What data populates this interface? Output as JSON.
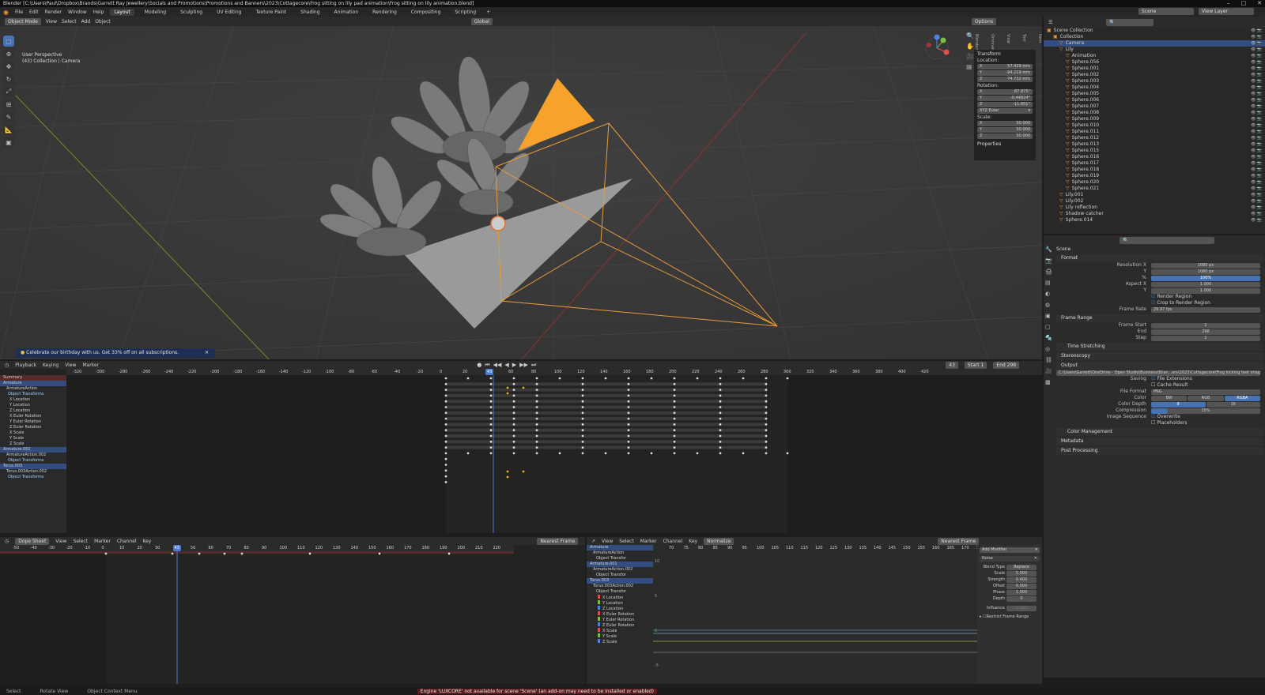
{
  "window": {
    "title": "Blender [C:\\Users\\Paul\\Dropbox\\Brands\\Garrett Ray Jewellery\\Socials and Promotions\\Promotions and Banners\\2023\\Cottagecore\\Frog sitting on lily pad animation\\Frog sitting on lily animation.blend]",
    "minimize": "–",
    "maximize": "□",
    "close": "✕"
  },
  "menubar": {
    "menus": [
      "File",
      "Edit",
      "Render",
      "Window",
      "Help"
    ],
    "workspaces": [
      "Layout",
      "Modeling",
      "Sculpting",
      "UV Editing",
      "Texture Paint",
      "Shading",
      "Animation",
      "Rendering",
      "Compositing",
      "Scripting"
    ],
    "active_workspace": "Layout",
    "add_tab": "+",
    "scene_label": "Scene",
    "view_layer_label": "View Layer"
  },
  "viewport": {
    "mode": "Object Mode",
    "menus": [
      "View",
      "Select",
      "Add",
      "Object"
    ],
    "orientation": "Global",
    "options": "Options",
    "info_line1": "User Perspective",
    "info_line2": "(43) Collection | Camera",
    "banner": "Celebrate our birthday with us. Get 33% off on all subscriptions.",
    "banner_close": "✕",
    "gizmo": {
      "x": "X",
      "y": "Y",
      "z": "Z"
    },
    "npanel_tabs": [
      "Item",
      "Tool",
      "View",
      "Omniverse",
      "Blenderkit"
    ]
  },
  "transform": {
    "header": "Transform",
    "location_label": "Location:",
    "location": [
      [
        "X",
        "57.429 mm"
      ],
      [
        "Y",
        "-94.219 mm"
      ],
      [
        "Z",
        "74.732 mm"
      ]
    ],
    "rotation_label": "Rotation:",
    "rotation": [
      [
        "X",
        "87.875°"
      ],
      [
        "Y",
        "-0.44824°"
      ],
      [
        "Z",
        "-11.851°"
      ]
    ],
    "rotation_mode": "XYZ Euler",
    "scale_label": "Scale:",
    "scale": [
      [
        "X",
        "50.000"
      ],
      [
        "Y",
        "50.000"
      ],
      [
        "Z",
        "50.000"
      ]
    ],
    "properties": "Properties"
  },
  "outliner": {
    "rows": [
      {
        "label": "Scene Collection",
        "indent": 0
      },
      {
        "label": "Collection",
        "indent": 1
      },
      {
        "label": "Camera",
        "indent": 2,
        "selected": true
      },
      {
        "label": "Lily",
        "indent": 2
      },
      {
        "label": "Animation",
        "indent": 3
      },
      {
        "label": "Sphere.056",
        "indent": 3
      },
      {
        "label": "Sphere.001",
        "indent": 3
      },
      {
        "label": "Sphere.002",
        "indent": 3
      },
      {
        "label": "Sphere.003",
        "indent": 3
      },
      {
        "label": "Sphere.004",
        "indent": 3
      },
      {
        "label": "Sphere.005",
        "indent": 3
      },
      {
        "label": "Sphere.006",
        "indent": 3
      },
      {
        "label": "Sphere.007",
        "indent": 3
      },
      {
        "label": "Sphere.008",
        "indent": 3
      },
      {
        "label": "Sphere.009",
        "indent": 3
      },
      {
        "label": "Sphere.010",
        "indent": 3
      },
      {
        "label": "Sphere.011",
        "indent": 3
      },
      {
        "label": "Sphere.012",
        "indent": 3
      },
      {
        "label": "Sphere.013",
        "indent": 3
      },
      {
        "label": "Sphere.015",
        "indent": 3
      },
      {
        "label": "Sphere.016",
        "indent": 3
      },
      {
        "label": "Sphere.017",
        "indent": 3
      },
      {
        "label": "Sphere.018",
        "indent": 3
      },
      {
        "label": "Sphere.019",
        "indent": 3
      },
      {
        "label": "Sphere.020",
        "indent": 3
      },
      {
        "label": "Sphere.021",
        "indent": 3
      },
      {
        "label": "Lily.001",
        "indent": 2
      },
      {
        "label": "Lily.002",
        "indent": 2
      },
      {
        "label": "Lily reflection",
        "indent": 2
      },
      {
        "label": "Shadow catcher",
        "indent": 2
      },
      {
        "label": "Sphere.014",
        "indent": 2
      }
    ]
  },
  "properties": {
    "scene": "Scene",
    "format_header": "Format",
    "resolution_x_label": "Resolution X",
    "resolution_x": "1080 px",
    "resolution_y_label": "Y",
    "resolution_y": "1080 px",
    "resolution_pct_label": "%",
    "resolution_pct": "100%",
    "aspect_x_label": "Aspect X",
    "aspect_x": "1.000",
    "aspect_y_label": "Y",
    "aspect_y": "1.000",
    "render_region": "Render Region",
    "crop": "Crop to Render Region",
    "frame_rate_label": "Frame Rate",
    "frame_rate": "29.97 fps",
    "frame_range_header": "Frame Range",
    "frame_start_label": "Frame Start",
    "frame_start": "1",
    "frame_end_label": "End",
    "frame_end": "298",
    "frame_step_label": "Step",
    "frame_step": "1",
    "time_stretching": "Time Stretching",
    "stereoscopy": "Stereoscopy",
    "output_header": "Output",
    "output_path": "C:\\Users\\Garrett\\OneDrive - Open Studio\\Business\\Bran...ers\\2023\\Cottagecore\\Frog kicking feet image sequence\\",
    "saving_label": "Saving",
    "file_ext": "File Extensions",
    "cache_result": "Cache Result",
    "file_format_label": "File Format",
    "file_format": "PNG",
    "color_label": "Color",
    "color_opts": [
      "BW",
      "RGB",
      "RGBA"
    ],
    "color_depth_label": "Color Depth",
    "color_depth": [
      "8",
      "16"
    ],
    "compression_label": "Compression",
    "compression": "15%",
    "image_seq_label": "Image Sequence",
    "overwrite": "Overwrite",
    "placeholders": "Placeholders",
    "color_mgmt": "Color Management",
    "metadata": "Metadata",
    "post_processing": "Post Processing"
  },
  "timeline": {
    "menus": [
      "Playback",
      "Keying",
      "View",
      "Marker"
    ],
    "current_frame": "43",
    "start_label": "Start",
    "start": "1",
    "end_label": "End",
    "end": "298",
    "ruler": [
      "-320",
      "-300",
      "-280",
      "-260",
      "-240",
      "-220",
      "-200",
      "-180",
      "-160",
      "-140",
      "-120",
      "-100",
      "-80",
      "-60",
      "-40",
      "-20",
      "0",
      "20",
      "43",
      "60",
      "80",
      "100",
      "120",
      "140",
      "160",
      "180",
      "200",
      "220",
      "240",
      "260",
      "280",
      "300",
      "320",
      "340",
      "360",
      "380",
      "400",
      "420"
    ],
    "channels": [
      {
        "label": "Summary",
        "kind": "summary"
      },
      {
        "label": "Armature",
        "kind": "obj"
      },
      {
        "label": "ArmatureAction",
        "kind": "act"
      },
      {
        "label": "Object Transforms",
        "kind": "grp"
      },
      {
        "label": "X Location",
        "kind": "ch"
      },
      {
        "label": "Y Location",
        "kind": "ch"
      },
      {
        "label": "Z Location",
        "kind": "ch"
      },
      {
        "label": "X Euler Rotation",
        "kind": "ch"
      },
      {
        "label": "Y Euler Rotation",
        "kind": "ch"
      },
      {
        "label": "Z Euler Rotation",
        "kind": "ch"
      },
      {
        "label": "X Scale",
        "kind": "ch"
      },
      {
        "label": "Y Scale",
        "kind": "ch"
      },
      {
        "label": "Z Scale",
        "kind": "ch"
      },
      {
        "label": "Armature.001",
        "kind": "obj"
      },
      {
        "label": "ArmatureAction.002",
        "kind": "act"
      },
      {
        "label": "Object Transforms",
        "kind": "grp"
      },
      {
        "label": "Torus.003",
        "kind": "obj"
      },
      {
        "label": "Torus.003Action.002",
        "kind": "act"
      },
      {
        "label": "Object Transforms",
        "kind": "grp"
      }
    ]
  },
  "dopesheet": {
    "mode": "Dope Sheet",
    "menus": [
      "View",
      "Select",
      "Marker",
      "Channel",
      "Key"
    ],
    "snap": "Nearest Frame",
    "ruler": [
      "-50",
      "-40",
      "-30",
      "-20",
      "-10",
      "0",
      "10",
      "20",
      "30",
      "43",
      "50",
      "60",
      "70",
      "80",
      "90",
      "100",
      "110",
      "120",
      "130",
      "140",
      "150",
      "160",
      "170",
      "180",
      "190",
      "200",
      "210",
      "220"
    ]
  },
  "graph": {
    "menus": [
      "View",
      "Select",
      "Marker",
      "Channel",
      "Key"
    ],
    "normalize": "Normalize",
    "snap": "Nearest Frame",
    "add_modifier": "Add Modifier",
    "ruler": [
      "70",
      "75",
      "80",
      "85",
      "90",
      "95",
      "100",
      "105",
      "110",
      "115",
      "120",
      "125",
      "130",
      "135",
      "140",
      "145",
      "150",
      "155",
      "160",
      "165",
      "170",
      "175"
    ],
    "yaxis": [
      "10",
      "5",
      "0",
      "-5"
    ],
    "channels": [
      "Armature",
      "ArmatureAction",
      "Object Transfor",
      "Armature.001",
      "ArmatureAction.002",
      "Object Transfor",
      "Torus.003",
      "Torus.003Action.002",
      "Object Transfor",
      "X Location",
      "Y Location",
      "Z Location",
      "X Euler Rotation",
      "Y Euler Rotation",
      "Z Euler Rotation",
      "X Scale",
      "Y Scale",
      "Z Scale"
    ],
    "modifier": {
      "name": "Noise",
      "blend_label": "Blend Type",
      "blend": "Replace",
      "scale_label": "Scale",
      "scale": "5.000",
      "strength_label": "Strength",
      "strength": "0.400",
      "offset_label": "Offset",
      "offset": "0.000",
      "phase_label": "Phase",
      "phase": "1.000",
      "depth_label": "Depth",
      "depth": "0",
      "influence_label": "Influence",
      "influence": "1.000",
      "restrict": "Restrict Frame Range"
    },
    "side_tabs": [
      "F-Curve",
      "Modifiers",
      "View"
    ]
  },
  "statusbar": {
    "select": "Select",
    "rotate": "Rotate View",
    "context": "Object Context Menu",
    "error": "Engine 'LUXCORE' not available for scene 'Scene' (an add-on may need to be installed or enabled)"
  },
  "colors": {
    "accent": "#4772b3",
    "selected_row": "#334d80",
    "camera": "#e89b3a",
    "playhead": "#4a7bd0"
  }
}
